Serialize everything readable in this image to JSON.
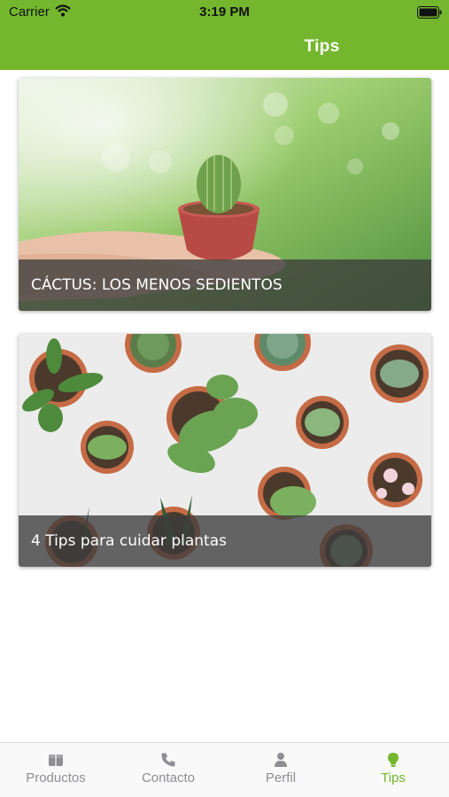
{
  "status_bar": {
    "carrier": "Carrier",
    "time": "3:19 PM"
  },
  "nav": {
    "title": "Tips"
  },
  "tips": [
    {
      "title": "CÁCTUS: LOS MENOS SEDIENTOS",
      "image": "cactus-in-hands-photo"
    },
    {
      "title": "4 Tips para cuidar plantas",
      "image": "succulent-pots-photo"
    }
  ],
  "tab_bar": {
    "items": [
      {
        "label": "Productos",
        "icon": "box-icon",
        "active": false
      },
      {
        "label": "Contacto",
        "icon": "phone-icon",
        "active": false
      },
      {
        "label": "Perfil",
        "icon": "person-icon",
        "active": false
      },
      {
        "label": "Tips",
        "icon": "lightbulb-icon",
        "active": true
      }
    ]
  },
  "colors": {
    "accent": "#74b72e",
    "inactive": "#8e8e93"
  }
}
